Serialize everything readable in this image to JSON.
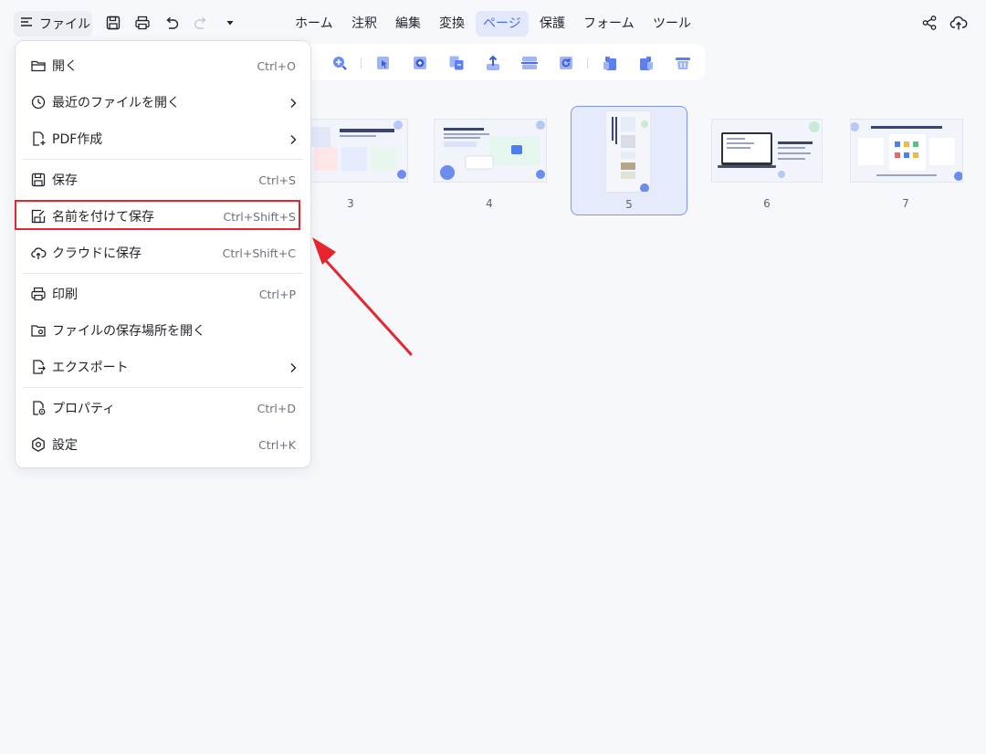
{
  "file_menu": {
    "label": "ファイル"
  },
  "menu_tabs": [
    {
      "label": "ホーム"
    },
    {
      "label": "注釈"
    },
    {
      "label": "編集"
    },
    {
      "label": "変換"
    },
    {
      "label": "ページ",
      "active": true
    },
    {
      "label": "保護"
    },
    {
      "label": "フォーム"
    },
    {
      "label": "ツール"
    }
  ],
  "quick_access_icons": [
    "save-icon",
    "print-icon",
    "undo-icon",
    "redo-icon",
    "more-dropdown-icon"
  ],
  "right_icons": [
    "share-icon",
    "cloud-upload-icon"
  ],
  "page_toolbar_icons": [
    "zoom-in-icon",
    "extract-page-icon",
    "insert-page-icon",
    "replace-page-icon",
    "export-page-icon",
    "split-page-icon",
    "rotate-page-icon",
    "rotate-left-icon",
    "rotate-right-icon",
    "delete-page-icon"
  ],
  "thumbnails": [
    {
      "number": "3",
      "selected": false
    },
    {
      "number": "4",
      "selected": false
    },
    {
      "number": "5",
      "selected": true
    },
    {
      "number": "6",
      "selected": false
    },
    {
      "number": "7",
      "selected": false
    }
  ],
  "dropdown": {
    "items": [
      {
        "label": "開く",
        "shortcut": "Ctrl+O",
        "icon": "folder-open-icon"
      },
      {
        "label": "最近のファイルを開く",
        "shortcut": "",
        "icon": "clock-icon",
        "submenu": true
      },
      {
        "label": "PDF作成",
        "shortcut": "",
        "icon": "new-file-icon",
        "submenu": true
      },
      {
        "label": "保存",
        "shortcut": "Ctrl+S",
        "icon": "save-icon"
      },
      {
        "label": "名前を付けて保存",
        "shortcut": "Ctrl+Shift+S",
        "icon": "save-as-icon",
        "highlighted": true
      },
      {
        "label": "クラウドに保存",
        "shortcut": "Ctrl+Shift+C",
        "icon": "cloud-save-icon"
      },
      {
        "label": "印刷",
        "shortcut": "Ctrl+P",
        "icon": "print-icon"
      },
      {
        "label": "ファイルの保存場所を開く",
        "shortcut": "",
        "icon": "folder-location-icon"
      },
      {
        "label": "エクスポート",
        "shortcut": "",
        "icon": "export-icon",
        "submenu": true
      },
      {
        "label": "プロパティ",
        "shortcut": "Ctrl+D",
        "icon": "properties-icon"
      },
      {
        "label": "設定",
        "shortcut": "Ctrl+K",
        "icon": "settings-icon"
      }
    ]
  },
  "colors": {
    "accent": "#4a6cf7",
    "highlight_red": "#e5262f",
    "background": "#f7f8fb"
  }
}
